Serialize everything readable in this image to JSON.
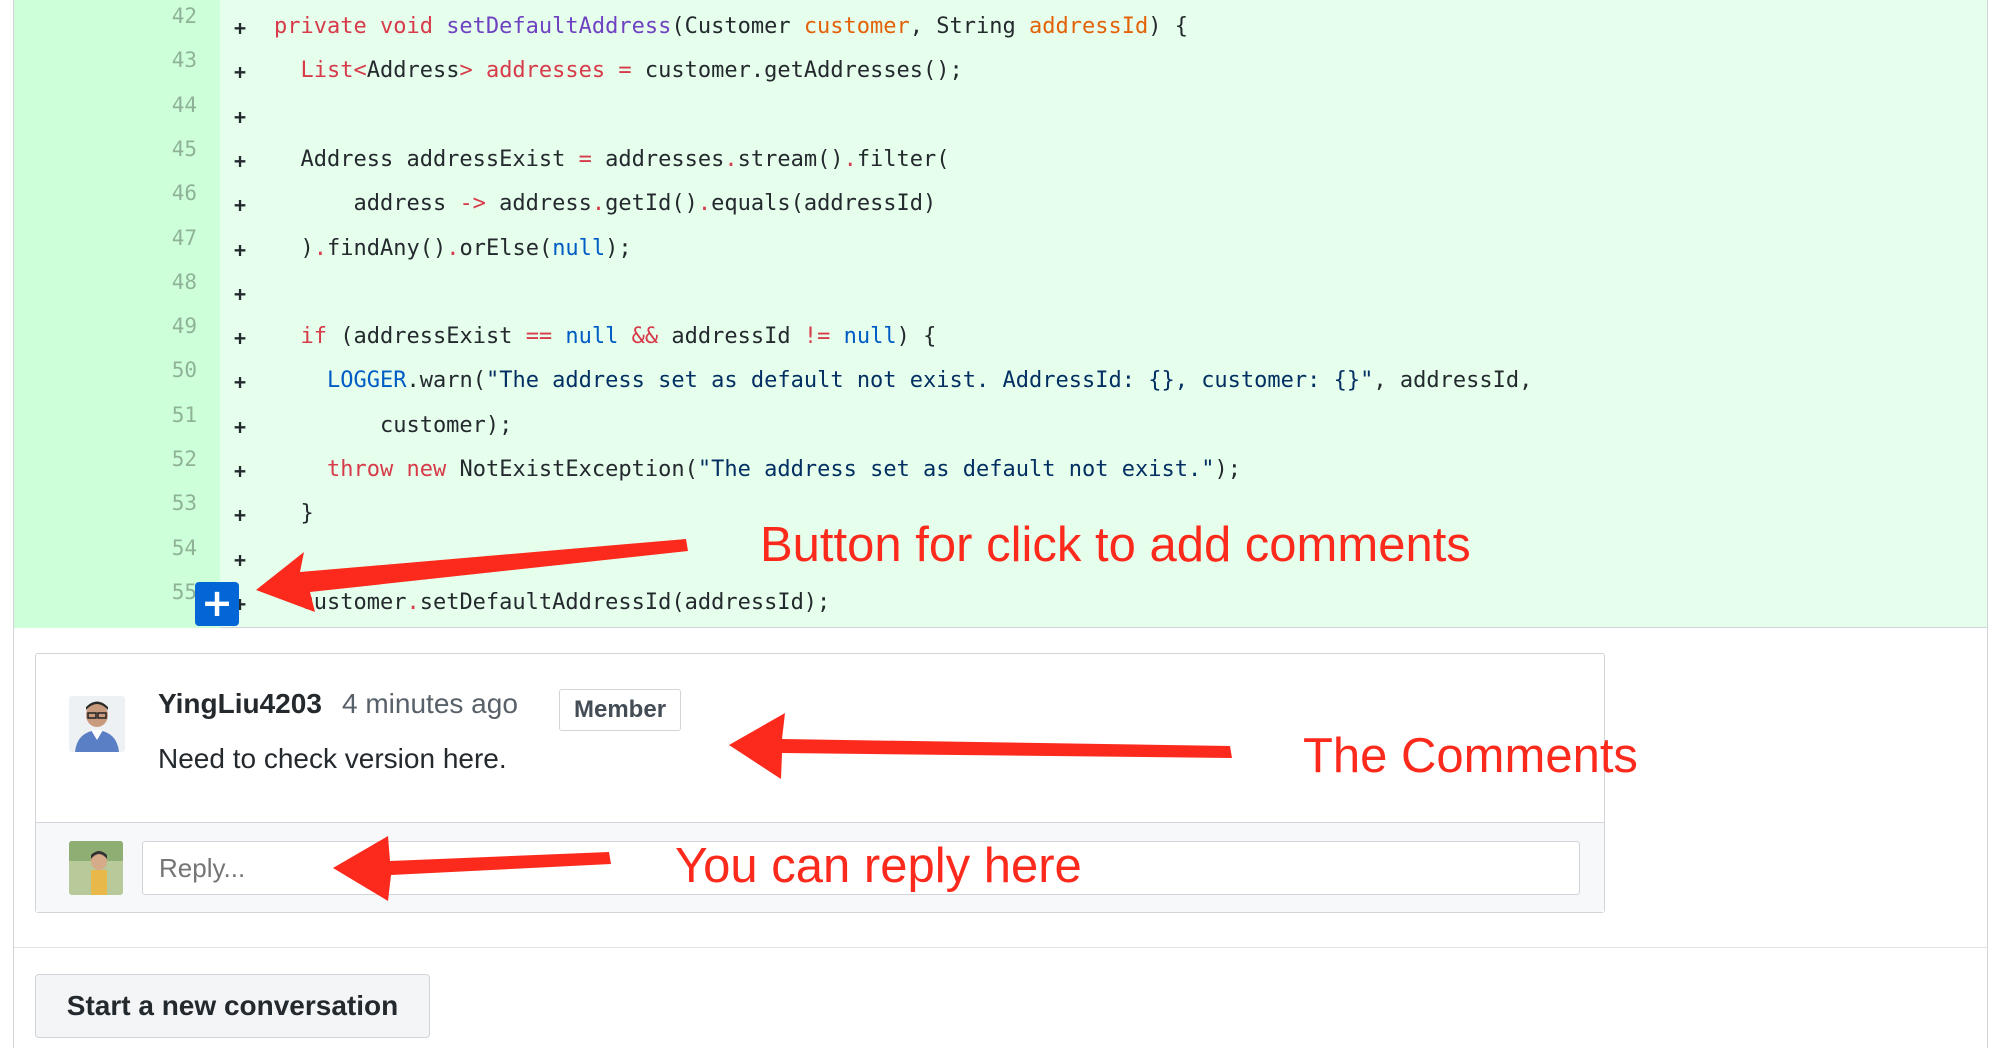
{
  "diff": {
    "lines": [
      {
        "num": "42",
        "marker": "+"
      },
      {
        "num": "43",
        "marker": "+"
      },
      {
        "num": "44",
        "marker": "+"
      },
      {
        "num": "45",
        "marker": "+"
      },
      {
        "num": "46",
        "marker": "+"
      },
      {
        "num": "47",
        "marker": "+"
      },
      {
        "num": "48",
        "marker": "+"
      },
      {
        "num": "49",
        "marker": "+"
      },
      {
        "num": "50",
        "marker": "+"
      },
      {
        "num": "51",
        "marker": "+"
      },
      {
        "num": "52",
        "marker": "+"
      },
      {
        "num": "53",
        "marker": "+"
      },
      {
        "num": "54",
        "marker": "+"
      },
      {
        "num": "55",
        "marker": "+"
      }
    ],
    "code": {
      "l42": {
        "a": "private void ",
        "b": "setDefaultAddress",
        "c": "(Customer ",
        "d": "customer",
        "e": ", String ",
        "f": "addressId",
        "g": ") {"
      },
      "l43": {
        "a": "  ",
        "b": "List<",
        "c": "Address",
        "d": "> addresses ",
        "e": "=",
        "f": " customer.getAddresses();"
      },
      "l45": {
        "a": "  Address addressExist ",
        "b": "=",
        "c": " addresses",
        "d": ".",
        "e": "stream()",
        "f": ".",
        "g": "filter("
      },
      "l46": {
        "a": "      address ",
        "b": "->",
        "c": " address",
        "d": ".",
        "e": "getId()",
        "f": ".",
        "g": "equals(addressId)"
      },
      "l47": {
        "a": "  )",
        "b": ".",
        "c": "findAny()",
        "d": ".",
        "e": "orElse(",
        "f": "null",
        "g": ");"
      },
      "l49": {
        "a": "  ",
        "b": "if",
        "c": " (addressExist ",
        "d": "==",
        "e": " null",
        "f": " && ",
        "g": "addressId ",
        "h": "!=",
        "i": " null",
        "j": ") {"
      },
      "l50": {
        "a": "    ",
        "b": "LOGGER",
        "c": ".warn(",
        "d": "\"The address set as default not exist. AddressId: {}, customer: {}\"",
        "e": ", addressId,"
      },
      "l51": {
        "a": "        customer);"
      },
      "l52": {
        "a": "    ",
        "b": "throw",
        "c": " ",
        "d": "new",
        "e": " NotExistException(",
        "f": "\"The address set as default not exist.\"",
        "g": ");"
      },
      "l53": {
        "a": "  }"
      },
      "l55": {
        "a": "  customer",
        "b": ".",
        "c": "setDefaultAddressId(addressId);"
      }
    },
    "add_button_glyph": "+"
  },
  "comment": {
    "author": "YingLiu4203",
    "time": "4 minutes ago",
    "badge": "Member",
    "body": "Need to check version here.",
    "reply_placeholder": "Reply..."
  },
  "new_conversation_label": "Start a new conversation",
  "annotations": {
    "add_button_note": "Button for click to add comments",
    "comments_note": "The Comments",
    "reply_note": "You can reply here",
    "color": "#fc2a1c"
  }
}
